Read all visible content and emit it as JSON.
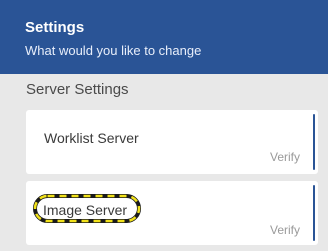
{
  "header": {
    "title": "Settings",
    "subtitle": "What would you like to change"
  },
  "section": {
    "title": "Server Settings"
  },
  "cards": [
    {
      "label": "Worklist Server",
      "action": "Verify"
    },
    {
      "label": "Image Server",
      "action": "Verify",
      "highlighted": true
    }
  ],
  "colors": {
    "header_bg": "#2a5496",
    "page_bg": "#e8e8e8",
    "highlight_outer": "#1a1a1a",
    "highlight_inner": "#f2e21a"
  }
}
